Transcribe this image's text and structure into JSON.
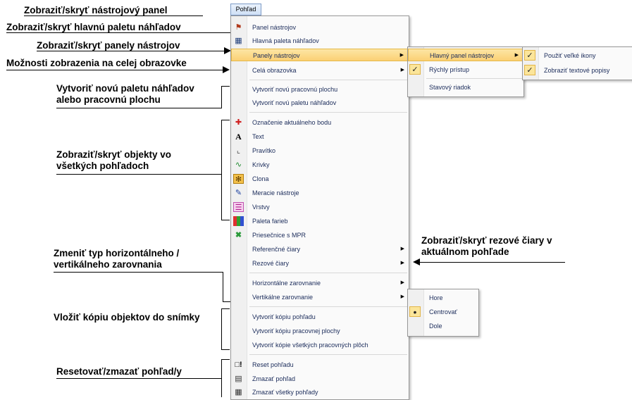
{
  "annotations": {
    "a1": "Zobraziť/skryť nástrojový panel",
    "a2": "Zobraziť/skryť hlavnú paletu náhľadov",
    "a3": "Zobraziť/skryť panely nástrojov",
    "a4": "Možnosti zobrazenia na celej obrazovke",
    "a5": "Vytvoriť novú paletu náhľadov alebo pracovnú plochu",
    "a6": "Zobraziť/skryť objekty vo všetkých pohľadoch",
    "a7": "Zobraziť/skryť rezové čiary v aktuálnom pohľade",
    "a8": "Zmeniť typ horizontálneho / vertikálneho zarovnania",
    "a9": "Vložiť kópiu objektov do snímky",
    "a10": "Resetovať/zmazať pohľad/y"
  },
  "menubar": {
    "tab": "Pohľad"
  },
  "menu": {
    "items": [
      {
        "label": "Panel nástrojov",
        "icon": "toolbar-icon"
      },
      {
        "label": "Hlavná paleta náhľadov",
        "icon": "palette-grid-icon"
      },
      {
        "label": "Panely nástrojov",
        "submenu": true,
        "highlighted": true
      },
      {
        "label": "Celá obrazovka",
        "submenu": true
      },
      {
        "label": "Vytvoriť novú pracovnú plochu"
      },
      {
        "label": "Vytvoriť novú paletu náhľadov"
      },
      {
        "label": "Označenie aktuálneho bodu",
        "icon": "crosshair-icon"
      },
      {
        "label": "Text",
        "icon": "text-icon"
      },
      {
        "label": "Pravítko",
        "icon": "ruler-icon"
      },
      {
        "label": "Krivky",
        "icon": "curve-icon"
      },
      {
        "label": "Clona",
        "icon": "aperture-icon"
      },
      {
        "label": "Meracie nástroje",
        "icon": "measure-icon"
      },
      {
        "label": "Vrstvy",
        "icon": "layers-icon"
      },
      {
        "label": "Paleta farieb",
        "icon": "color-palette-icon"
      },
      {
        "label": "Priesečnice s MPR",
        "icon": "mpr-cross-icon"
      },
      {
        "label": "Referenčné čiary",
        "submenu": true
      },
      {
        "label": "Rezové čiary",
        "submenu": true
      },
      {
        "label": "Horizontálne zarovnanie",
        "submenu": true
      },
      {
        "label": "Vertikálne zarovnanie",
        "submenu": true
      },
      {
        "label": "Vytvoriť kópiu pohľadu"
      },
      {
        "label": "Vytvoriť kópiu pracovnej plochy"
      },
      {
        "label": "Vytvoriť kópie všetkých pracovných plôch"
      },
      {
        "label": "Reset pohľadu",
        "icon": "reset-icon"
      },
      {
        "label": "Zmazať pohľad",
        "icon": "erase-view-icon"
      },
      {
        "label": "Zmazať všetky pohľady",
        "icon": "erase-all-icon"
      }
    ]
  },
  "toolbars_submenu": {
    "items": [
      {
        "label": "Hlavný panel nástrojov",
        "submenu": true,
        "highlighted": true
      },
      {
        "label": "Rýchly prístup",
        "checked": true
      },
      {
        "label": "Stavový riadok"
      }
    ]
  },
  "main_toolbar_submenu": {
    "items": [
      {
        "label": "Použiť veľké ikony",
        "checked": true
      },
      {
        "label": "Zobraziť textové popisy",
        "checked": true
      }
    ]
  },
  "vertical_align_submenu": {
    "items": [
      {
        "label": "Hore"
      },
      {
        "label": "Centrovať",
        "selected": true
      },
      {
        "label": "Dole"
      }
    ]
  }
}
